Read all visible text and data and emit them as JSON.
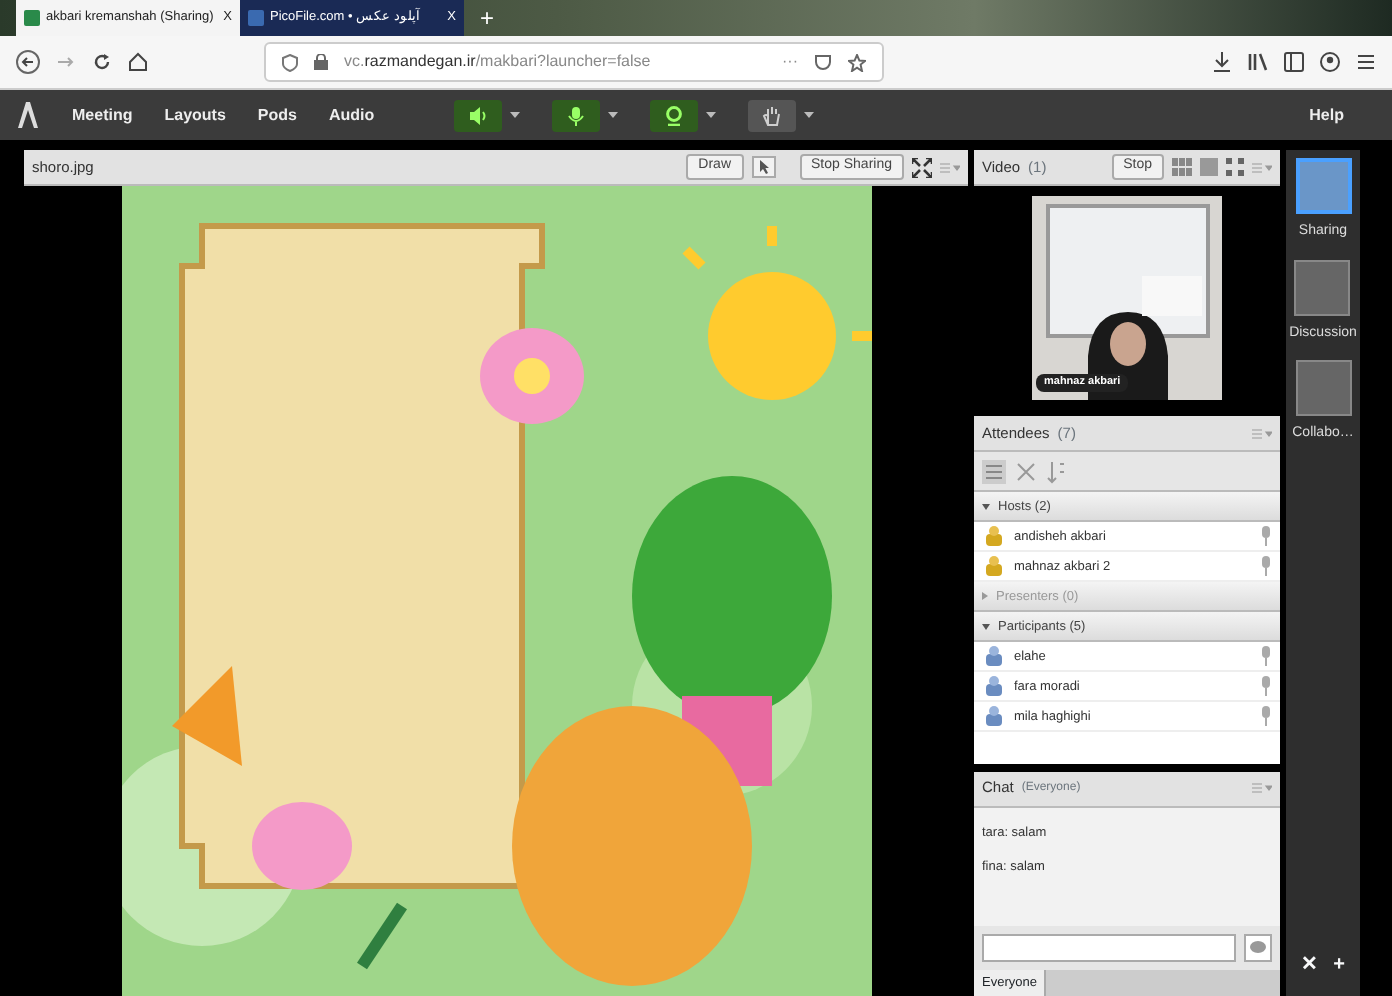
{
  "browser": {
    "tabs": [
      {
        "title": "akbari kremanshah (Sharing)",
        "close": "X",
        "selected": true
      },
      {
        "title": "PicoFile.com • آپلود عکس",
        "close": "X",
        "selected": false
      }
    ],
    "new_tab": "+",
    "url": "vc.**razmandegan.ir**/makbari?launcher=false",
    "more": "···"
  },
  "menubar": {
    "items": [
      "Meeting",
      "Layouts",
      "Pods",
      "Audio"
    ],
    "help": "Help",
    "toggles": [
      {
        "kind": "speaker",
        "on": true
      },
      {
        "kind": "mic",
        "on": true
      },
      {
        "kind": "camera",
        "on": true
      },
      {
        "kind": "hand",
        "on": false
      }
    ]
  },
  "share_pod": {
    "title": "shoro.jpg",
    "draw": "Draw",
    "stop": "Stop Sharing"
  },
  "video_pod": {
    "title": "Video",
    "count": "(1)",
    "stop": "Stop",
    "name_tag": "mahnaz akbari"
  },
  "attendees_pod": {
    "title": "Attendees",
    "count": "(7)",
    "groups": [
      {
        "label": "Hosts (2)",
        "expanded": true,
        "people": [
          "andisheh akbari",
          "mahnaz akbari 2"
        ]
      },
      {
        "label": "Presenters (0)",
        "expanded": false
      },
      {
        "label": "Participants (5)",
        "expanded": true,
        "people": [
          "elahe",
          "fara moradi",
          "mila haghighi"
        ]
      }
    ]
  },
  "chat_pod": {
    "title": "Chat",
    "scope": "(Everyone)",
    "messages": [
      "tara: salam",
      "fina: salam"
    ],
    "tab": "Everyone"
  },
  "layouts": [
    {
      "label": "Sharing",
      "selected": true
    },
    {
      "label": "Discussion",
      "selected": false
    },
    {
      "label": "Collabo…",
      "selected": false
    }
  ],
  "layout_actions": [
    "✕",
    "+"
  ]
}
